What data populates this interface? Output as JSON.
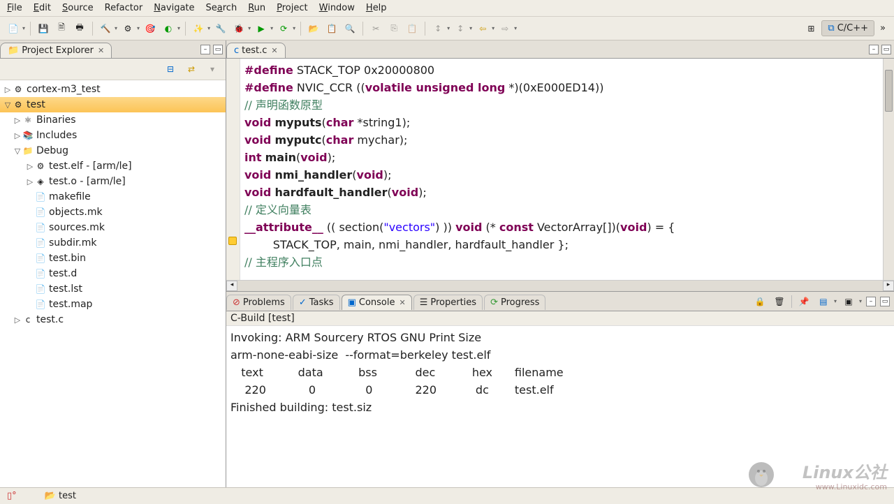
{
  "menu": {
    "file": "File",
    "edit": "Edit",
    "source": "Source",
    "refactor": "Refactor",
    "navigate": "Navigate",
    "search": "Search",
    "run": "Run",
    "project": "Project",
    "window": "Window",
    "help": "Help"
  },
  "perspective": {
    "label": "C/C++"
  },
  "projectExplorer": {
    "title": "Project Explorer",
    "items": [
      {
        "label": "cortex-m3_test",
        "icon": "project-icon",
        "tw": "▷",
        "indent": 0
      },
      {
        "label": "test",
        "icon": "project-icon",
        "tw": "▽",
        "indent": 0,
        "selected": true
      },
      {
        "label": "Binaries",
        "icon": "binaries-icon",
        "tw": "▷",
        "indent": 1
      },
      {
        "label": "Includes",
        "icon": "includes-icon",
        "tw": "▷",
        "indent": 1
      },
      {
        "label": "Debug",
        "icon": "folder-icon",
        "tw": "▽",
        "indent": 1
      },
      {
        "label": "test.elf - [arm/le]",
        "icon": "elf-icon",
        "tw": "▷",
        "indent": 2
      },
      {
        "label": "test.o - [arm/le]",
        "icon": "obj-icon",
        "tw": "▷",
        "indent": 2
      },
      {
        "label": "makefile",
        "icon": "file-icon",
        "tw": "",
        "indent": 2
      },
      {
        "label": "objects.mk",
        "icon": "file-icon",
        "tw": "",
        "indent": 2
      },
      {
        "label": "sources.mk",
        "icon": "file-icon",
        "tw": "",
        "indent": 2
      },
      {
        "label": "subdir.mk",
        "icon": "file-icon",
        "tw": "",
        "indent": 2
      },
      {
        "label": "test.bin",
        "icon": "file-icon",
        "tw": "",
        "indent": 2
      },
      {
        "label": "test.d",
        "icon": "file-icon",
        "tw": "",
        "indent": 2
      },
      {
        "label": "test.lst",
        "icon": "file-icon",
        "tw": "",
        "indent": 2
      },
      {
        "label": "test.map",
        "icon": "file-icon",
        "tw": "",
        "indent": 2
      },
      {
        "label": "test.c",
        "icon": "cfile-icon",
        "tw": "▷",
        "indent": 1
      }
    ]
  },
  "editor": {
    "tab": "test.c",
    "code_html": "<span class=\"kw\">#define</span> STACK_TOP 0x20000800\n<span class=\"kw\">#define</span> NVIC_CCR ((<span class=\"kw\">volatile unsigned long</span> *)(0xE000ED14))\n<span class=\"cm\">// 声明函数原型</span>\n<span class=\"kw\">void</span> <b>myputs</b>(<span class=\"kw\">char</span> *string1);\n<span class=\"kw\">void</span> <b>myputc</b>(<span class=\"kw\">char</span> mychar);\n<span class=\"kw\">int</span> <b>main</b>(<span class=\"kw\">void</span>);\n<span class=\"kw\">void</span> <b>nmi_handler</b>(<span class=\"kw\">void</span>);\n<span class=\"kw\">void</span> <b>hardfault_handler</b>(<span class=\"kw\">void</span>);\n<span class=\"cm\">// 定义向量表</span>\n<span class=\"kw\">__attribute__</span> (( section(<span class=\"str\">\"vectors\"</span>) )) <span class=\"kw\">void</span> (* <span class=\"kw\">const</span> VectorArray[])(<span class=\"kw\">void</span>) = {\n        STACK_TOP, main, nmi_handler, hardfault_handler };\n<span class=\"cm\">// 主程序入口点</span>"
  },
  "bottom": {
    "tabs": {
      "problems": "Problems",
      "tasks": "Tasks",
      "console": "Console",
      "properties": "Properties",
      "progress": "Progress"
    },
    "consoleHeader": "C-Build [test]",
    "consoleText": "Invoking: ARM Sourcery RTOS GNU Print Size\narm-none-eabi-size  --format=berkeley test.elf\n   text\t   data\t    bss\t    dec\t    hex\tfilename\n    220\t      0\t      0\t    220\t     dc\ttest.elf\nFinished building: test.siz"
  },
  "status": {
    "project": "test"
  },
  "watermark": {
    "main": "Linux公社",
    "sub": "www.Linuxidc.com"
  }
}
